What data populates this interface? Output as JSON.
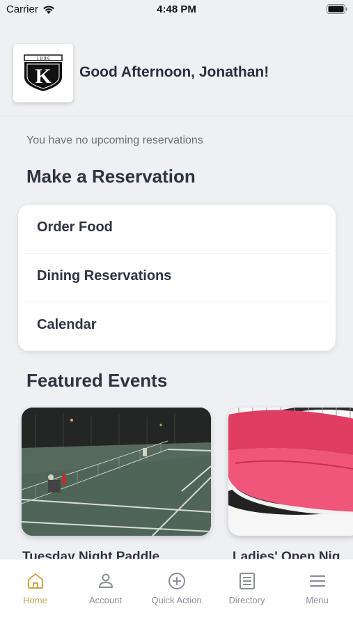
{
  "status": {
    "carrier": "Carrier",
    "time": "4:48 PM"
  },
  "header": {
    "logo_year": "1 8 9 6",
    "logo_letter": "K",
    "greeting": "Good Afternoon, Jonathan!"
  },
  "reservations": {
    "empty_text": "You have no upcoming reservations",
    "title": "Make a Reservation",
    "items": [
      {
        "label": "Order Food"
      },
      {
        "label": "Dining Reservations"
      },
      {
        "label": "Calendar"
      }
    ]
  },
  "events": {
    "title": "Featured Events",
    "items": [
      {
        "name": "Tuesday Night Paddle"
      },
      {
        "name": "Ladies' Open Nig"
      }
    ]
  },
  "tabs": [
    {
      "label": "Home",
      "icon": "home-icon",
      "active": true
    },
    {
      "label": "Account",
      "icon": "account-icon"
    },
    {
      "label": "Quick Action",
      "icon": "plus-circle-icon"
    },
    {
      "label": "Directory",
      "icon": "directory-icon"
    },
    {
      "label": "Menu",
      "icon": "menu-icon"
    }
  ],
  "colors": {
    "accent": "#c9a84e",
    "background": "#eef0f4",
    "text": "#2d3340"
  }
}
